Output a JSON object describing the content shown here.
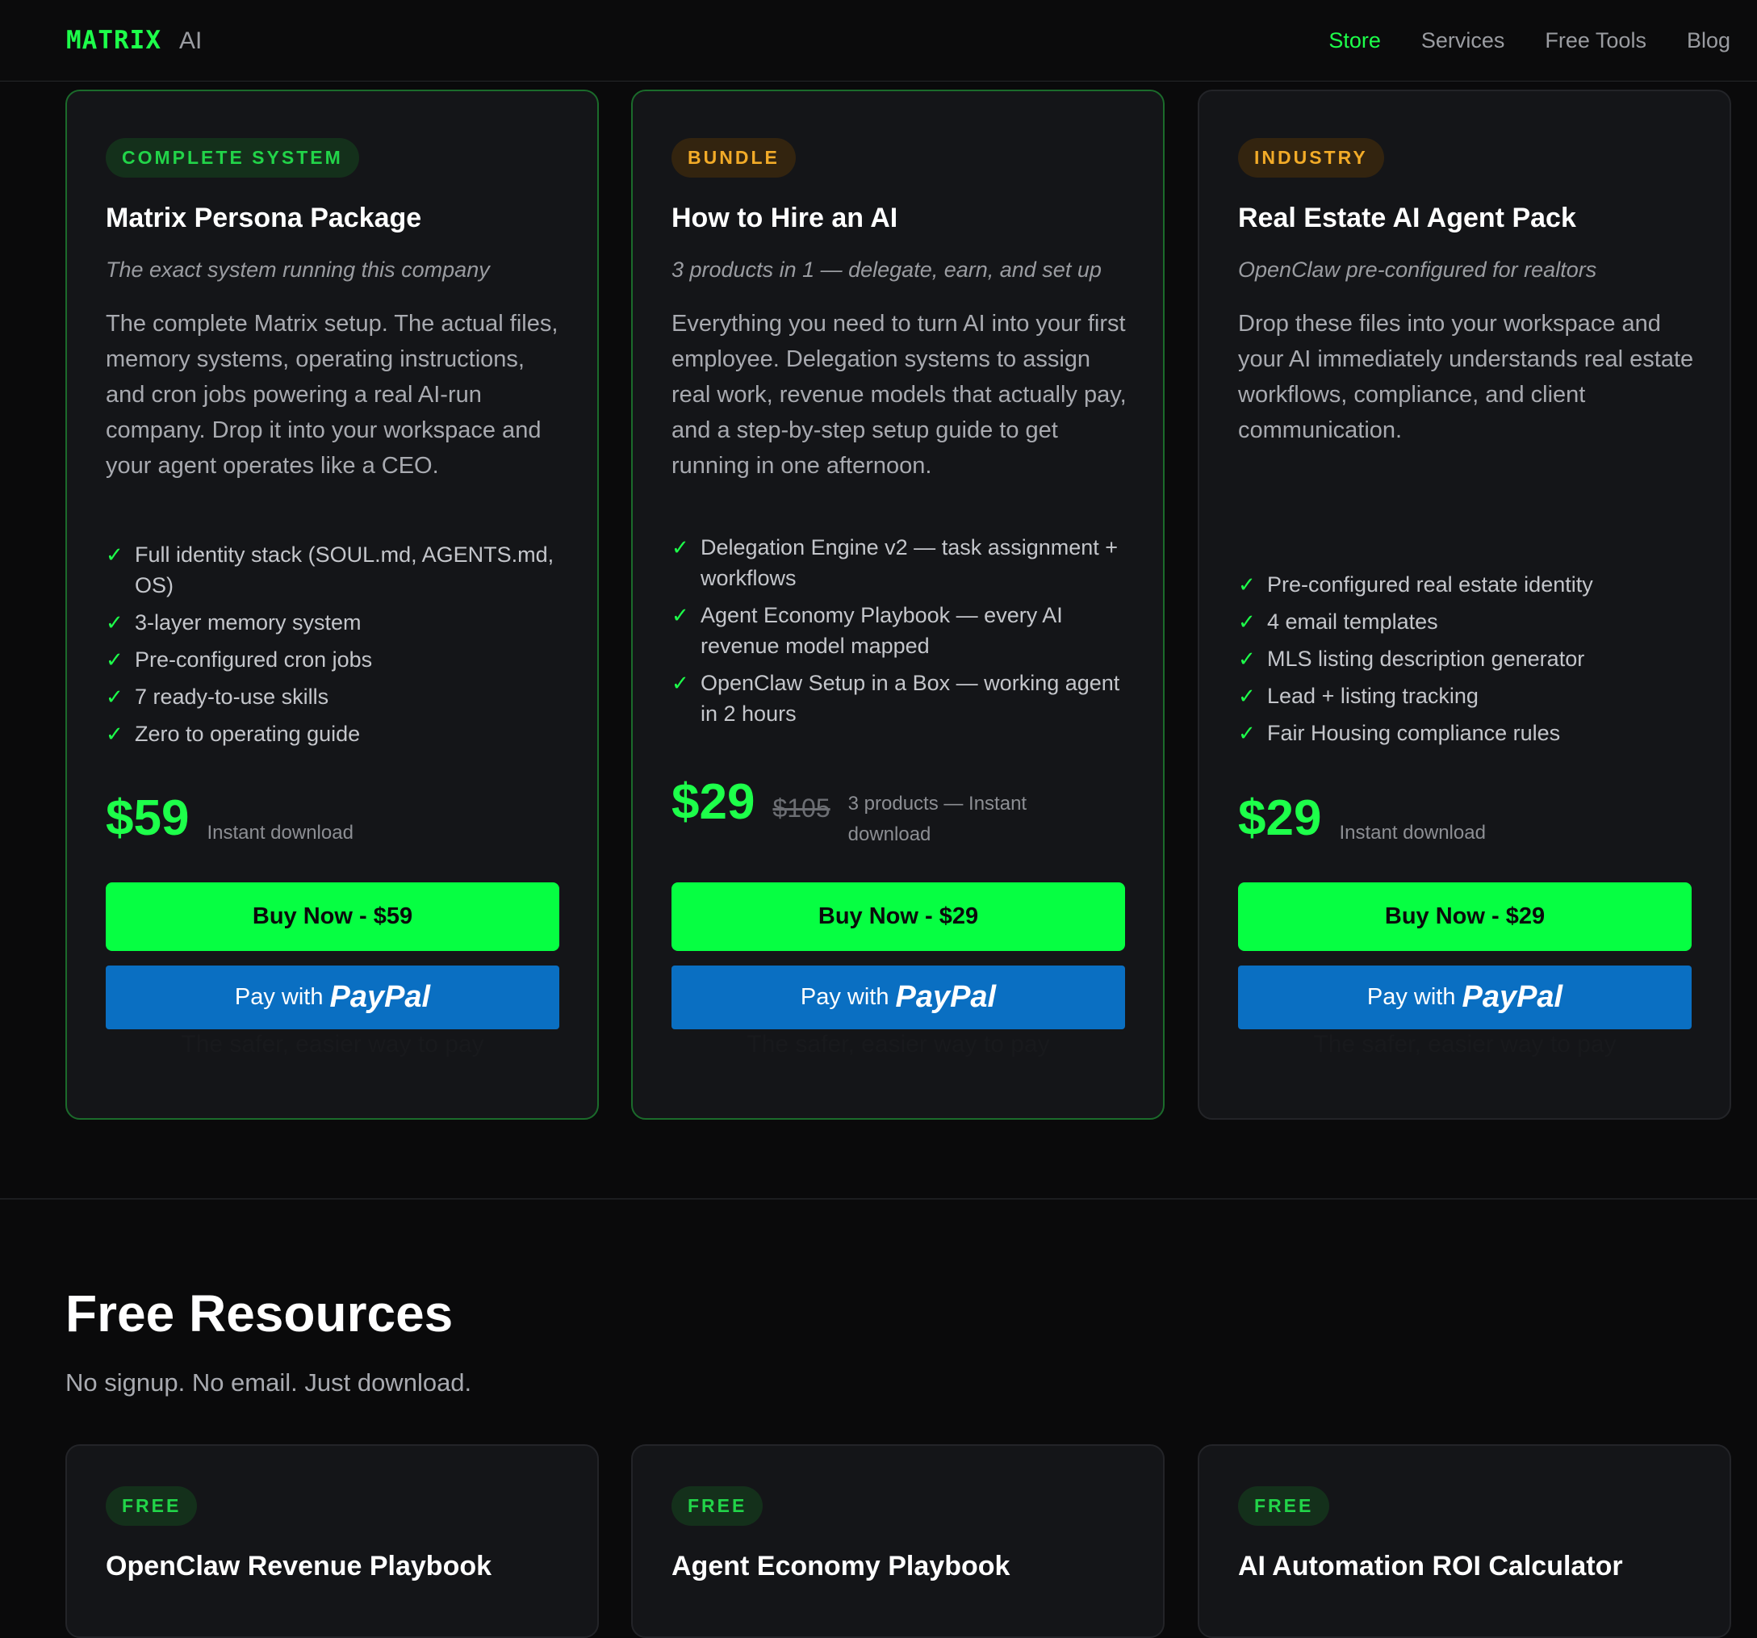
{
  "header": {
    "brand_main": "MATRIX",
    "brand_sub": "AI",
    "nav": [
      {
        "label": "Store",
        "active": true
      },
      {
        "label": "Services",
        "active": false
      },
      {
        "label": "Free Tools",
        "active": false
      },
      {
        "label": "Blog",
        "active": false
      }
    ]
  },
  "products": [
    {
      "badge": "COMPLETE SYSTEM",
      "title": "Matrix Persona Package",
      "subtitle": "The exact system running this company",
      "description": "The complete Matrix setup. The actual files, memory systems, operating instructions, and cron jobs powering a real AI-run company. Drop it into your workspace and your agent operates like a CEO.",
      "features": [
        "Full identity stack (SOUL.md, AGENTS.md, OS)",
        "3-layer memory system",
        "Pre-configured cron jobs",
        "7 ready-to-use skills",
        "Zero to operating guide"
      ],
      "price": "$59",
      "price_old": "",
      "price_note": "Instant download",
      "buy_label": "Buy Now - $59",
      "paypal_with": "Pay with",
      "paypal_brand": "PayPal",
      "paypal_tagline": "The safer, easier way to pay"
    },
    {
      "badge": "BUNDLE",
      "title": "How to Hire an AI",
      "subtitle": "3 products in 1 — delegate, earn, and set up",
      "description": "Everything you need to turn AI into your first employee. Delegation systems to assign real work, revenue models that actually pay, and a step-by-step setup guide to get running in one afternoon.",
      "features": [
        "Delegation Engine v2 — task assignment + workflows",
        "Agent Economy Playbook — every AI revenue model mapped",
        "OpenClaw Setup in a Box — working agent in 2 hours"
      ],
      "price": "$29",
      "price_old": "$105",
      "price_note": "3 products — Instant download",
      "buy_label": "Buy Now - $29",
      "paypal_with": "Pay with",
      "paypal_brand": "PayPal",
      "paypal_tagline": "The safer, easier way to pay"
    },
    {
      "badge": "INDUSTRY",
      "title": "Real Estate AI Agent Pack",
      "subtitle": "OpenClaw pre-configured for realtors",
      "description": "Drop these files into your workspace and your AI immediately understands real estate workflows, compliance, and client communication.",
      "features": [
        "Pre-configured real estate identity",
        "4 email templates",
        "MLS listing description generator",
        "Lead + listing tracking",
        "Fair Housing compliance rules"
      ],
      "price": "$29",
      "price_old": "",
      "price_note": "Instant download",
      "buy_label": "Buy Now - $29",
      "paypal_with": "Pay with",
      "paypal_brand": "PayPal",
      "paypal_tagline": "The safer, easier way to pay"
    }
  ],
  "free_section": {
    "title": "Free Resources",
    "subtitle": "No signup. No email. Just download.",
    "items": [
      {
        "badge": "FREE",
        "title": "OpenClaw Revenue Playbook"
      },
      {
        "badge": "FREE",
        "title": "Agent Economy Playbook"
      },
      {
        "badge": "FREE",
        "title": "AI Automation ROI Calculator"
      }
    ]
  },
  "colors": {
    "accent": "#1dff4a",
    "buy_button": "#06ff42",
    "paypal": "#0a6fc2",
    "badge_orange": "#f2ab28",
    "background": "#0a0a0b",
    "card": "#141518"
  },
  "icons": [
    "check-icon"
  ]
}
